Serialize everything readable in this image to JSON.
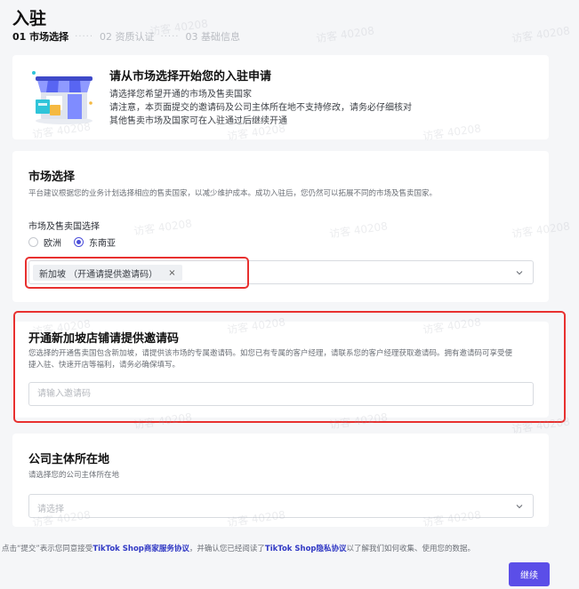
{
  "page": {
    "title": "入驻"
  },
  "steps": [
    {
      "label": "01 市场选择"
    },
    {
      "label": "02 资质认证"
    },
    {
      "label": "03 基础信息"
    }
  ],
  "step_separator": "·····",
  "intro": {
    "title": "请从市场选择开始您的入驻申请",
    "lines": [
      "请选择您希望开通的市场及售卖国家",
      "请注意，本页面提交的邀请码及公司主体所在地不支持修改，请务必仔细核对",
      "其他售卖市场及国家可在入驻通过后继续开通"
    ]
  },
  "market": {
    "title": "市场选择",
    "description": "平台建议根据您的业务计划选择相应的售卖国家，以减少维护成本。成功入驻后，您仍然可以拓展不同的市场及售卖国家。",
    "sub_label": "市场及售卖国选择",
    "radios": [
      {
        "label": "欧洲",
        "checked": false
      },
      {
        "label": "东南亚",
        "checked": true
      }
    ],
    "selected_tag": "新加坡 （开通请提供邀请码）",
    "tag_close": "×"
  },
  "invite": {
    "title": "开通新加坡店铺请提供邀请码",
    "description_line1": "您选择的开通售卖国包含新加坡，请提供该市场的专属邀请码。如您已有专属的客户经理，请联系您的客户经理获取邀请码。拥有邀请码可享受便",
    "description_line2": "捷入驻、快速开店等福利，请务必确保填写。",
    "input_placeholder": "请输入邀请码",
    "input_value": ""
  },
  "company": {
    "title": "公司主体所在地",
    "description": "请选择您的公司主体所在地",
    "select_placeholder": "请选择"
  },
  "footer": {
    "note_prefix": "点击“提交”表示您同意接受",
    "link1": "TikTok Shop商家服务协议",
    "note_middle": "，并确认您已经阅读了",
    "link2": "TikTok Shop隐私协议",
    "note_suffix": "以了解我们如何收集、使用您的数据。",
    "continue_label": "继续"
  },
  "watermark": "访客 40208",
  "colors": {
    "accent": "#5b4ee8",
    "radio_checked": "#4c4fd9",
    "highlight_border": "#e8302f",
    "link": "#3038c4"
  }
}
